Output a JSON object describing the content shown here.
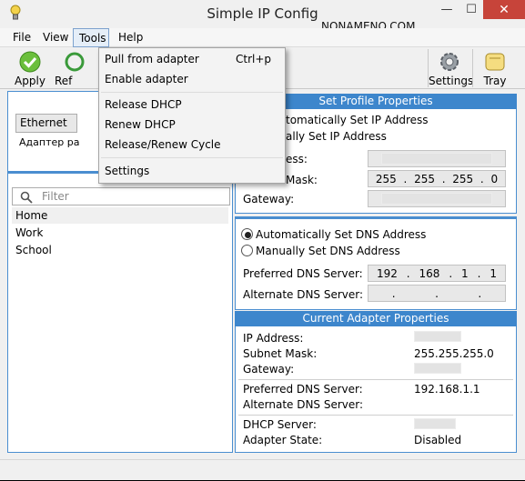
{
  "window": {
    "title": "Simple IP Config",
    "watermark": "NONAMENO.COM"
  },
  "menubar": {
    "file": "File",
    "view": "View",
    "tools": "Tools",
    "help": "Help"
  },
  "toolbar": {
    "apply": "Apply",
    "refresh_partial": "Ref",
    "settings": "Settings",
    "tray": "Tray"
  },
  "tools_menu": {
    "pull": "Pull from adapter",
    "pull_shortcut": "Ctrl+p",
    "enable": "Enable adapter",
    "release": "Release DHCP",
    "renew": "Renew DHCP",
    "release_renew": "Release/Renew Cycle",
    "settings": "Settings"
  },
  "left": {
    "adapter_select": "Ethernet",
    "adapter_desc_partial": "Адаптер ра",
    "filter_placeholder": "Filter",
    "profiles": [
      "Home",
      "Work",
      "School"
    ]
  },
  "set_profile": {
    "header": "Set Profile Properties",
    "auto_ip_partial": "tomatically Set IP Address",
    "manual_ip_partial": "ally Set IP Address",
    "ip_label_partial": "ess:",
    "mask_label_partial": "Mask:",
    "mask": [
      "255",
      "255",
      "255",
      "0"
    ],
    "gateway_label": "Gateway:",
    "auto_dns": "Automatically Set DNS Address",
    "manual_dns": "Manually Set DNS Address",
    "pref_dns_label": "Preferred DNS Server:",
    "pref_dns": [
      "192",
      "168",
      "1",
      "1"
    ],
    "alt_dns_label": "Alternate DNS Server:"
  },
  "current": {
    "header": "Current Adapter Properties",
    "ip_label": "IP Address:",
    "mask_label": "Subnet Mask:",
    "mask": "255.255.255.0",
    "gateway_label": "Gateway:",
    "pref_dns_label": "Preferred DNS Server:",
    "pref_dns": "192.168.1.1",
    "alt_dns_label": "Alternate DNS Server:",
    "dhcp_label": "DHCP Server:",
    "state_label": "Adapter State:",
    "state": "Disabled"
  }
}
